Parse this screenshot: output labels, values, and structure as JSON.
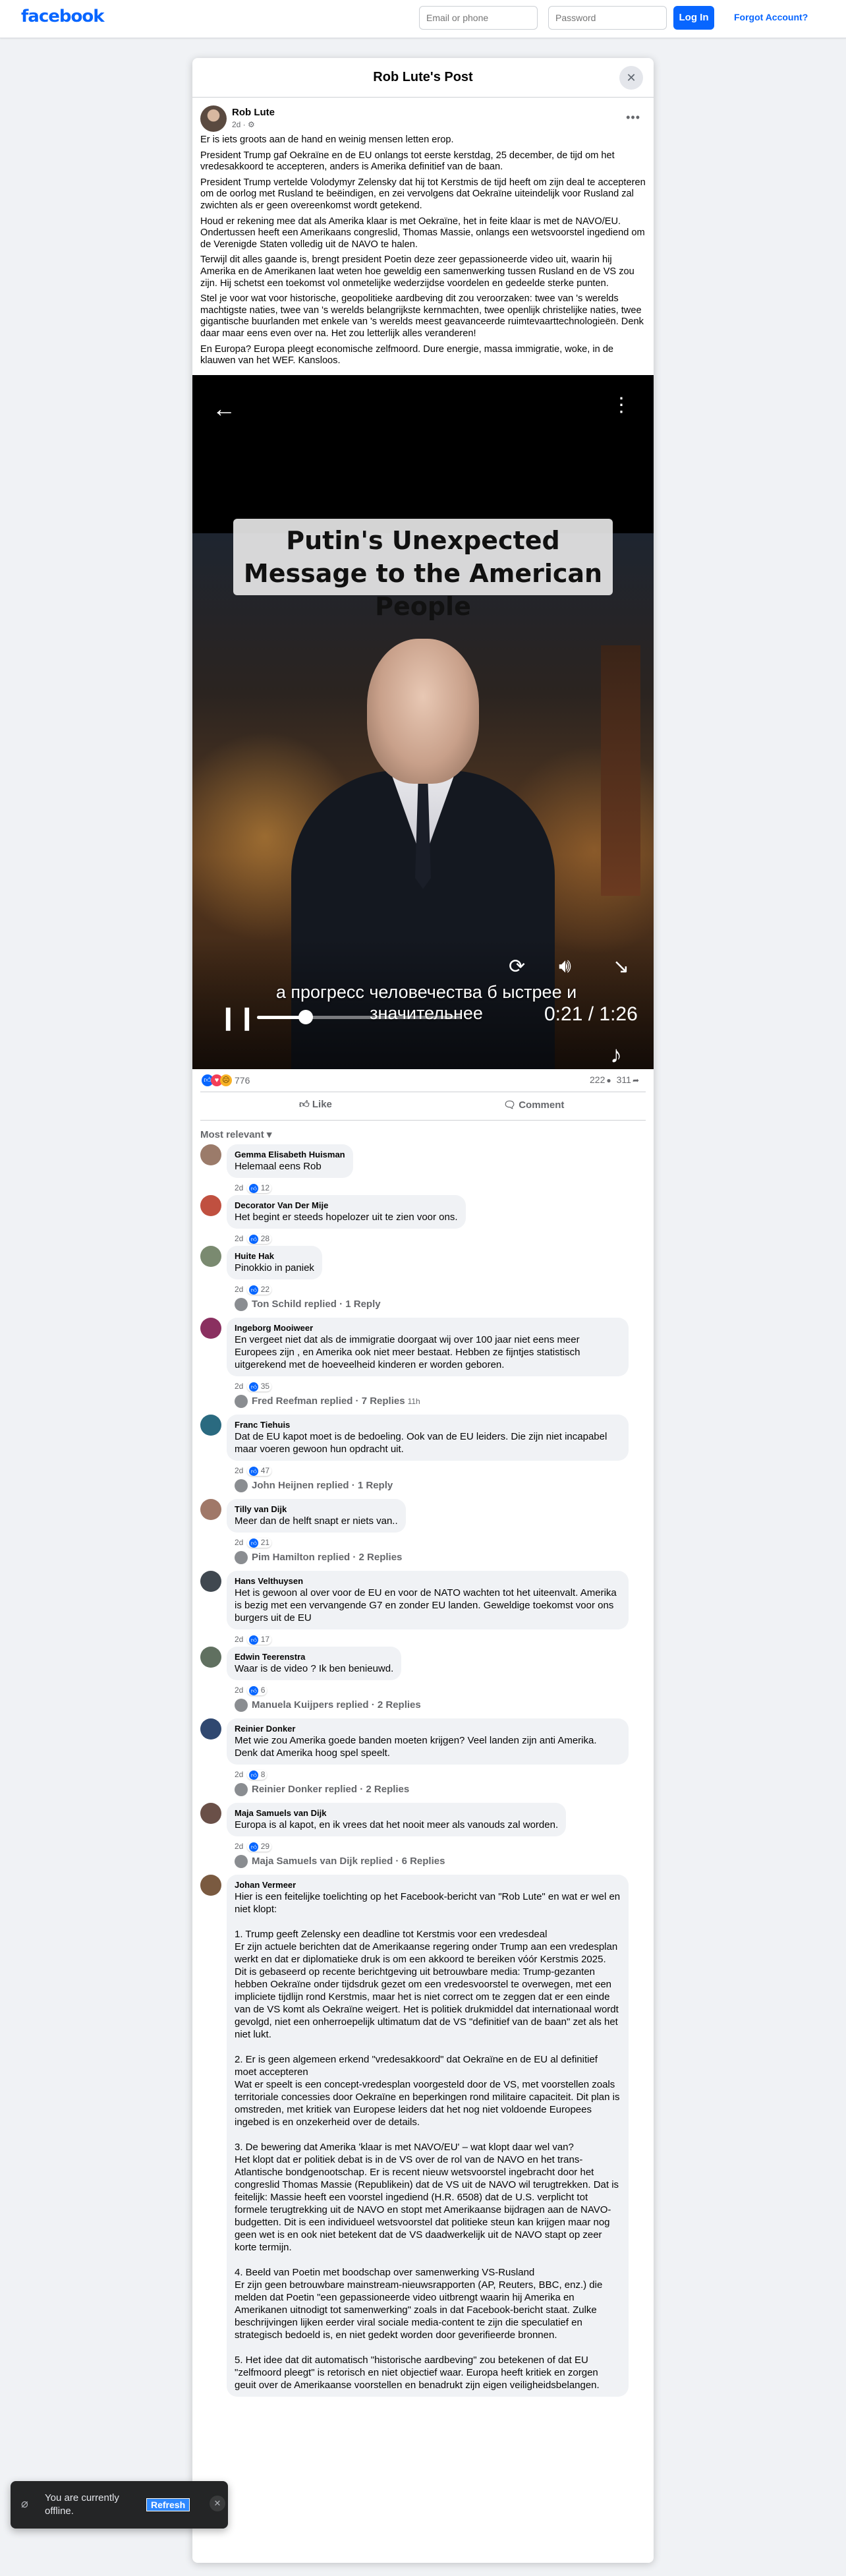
{
  "topbar": {
    "logo": "facebook",
    "email_placeholder": "Email or phone",
    "password_placeholder": "Password",
    "login_label": "Log In",
    "forgot_label": "Forgot Account?"
  },
  "post": {
    "title": "Rob Lute's Post",
    "close_icon": "close-icon",
    "author": "Rob Lute",
    "meta": "2d · ⚙",
    "more_icon": "more-icon",
    "paragraphs": [
      "Er is iets groots aan de hand en weinig mensen letten erop.",
      "President Trump gaf Oekraïne en de EU onlangs tot eerste kerstdag, 25 december, de tijd om het vredesakkoord te accepteren, anders is Amerika definitief van de baan.",
      "President Trump vertelde Volodymyr Zelensky dat hij tot Kerstmis de tijd heeft om zijn deal te accepteren om de oorlog met Rusland te beëindigen, en zei vervolgens dat Oekraïne uiteindelijk voor Rusland zal zwichten als er geen overeenkomst wordt getekend.",
      "Houd er rekening mee dat als Amerika klaar is met Oekraïne, het in feite klaar is met de NAVO/EU. Ondertussen heeft een Amerikaans congreslid, Thomas Massie, onlangs een wetsvoorstel ingediend om de Verenigde Staten volledig uit de NAVO te halen.",
      "Terwijl dit alles gaande is, brengt president Poetin deze zeer gepassioneerde video uit, waarin hij Amerika en de Amerikanen laat weten hoe geweldig een samenwerking tussen Rusland en de VS zou zijn. Hij schetst een toekomst vol onmetelijke wederzijdse voordelen en gedeelde sterke punten.",
      "Stel je voor wat voor historische, geopolitieke aardbeving dit zou veroorzaken: twee van 's werelds machtigste naties, twee van 's werelds belangrijkste kernmachten, twee openlijk christelijke naties, twee gigantische buurlanden met enkele van 's werelds meest geavanceerde ruimtevaarttechnologieën. Denk daar maar eens even over na. Het zou letterlijk alles veranderen!",
      "En Europa? Europa pleegt economische zelfmoord. Dure energie, massa immigratie, woke, in de klauwen van het WEF. Kansloos."
    ]
  },
  "video": {
    "banner": "Putin's Unexpected Message to the American People",
    "subtitle": "а прогресс человечества б ыстрее и значительнее",
    "time": "0:21 / 1:26",
    "progress": 0.24,
    "back_icon": "arrow-left-icon",
    "more_icon": "vertical-dots-icon",
    "replay_icon": "replay-icon",
    "volume_icon": "volume-icon",
    "minimize_icon": "minimize-icon",
    "pause_icon": "pause-icon",
    "watermark_icon": "tiktok-icon"
  },
  "stats": {
    "reactions": "776",
    "comments": "222",
    "shares": "311"
  },
  "actions": {
    "like": "Like",
    "comment": "Comment"
  },
  "sort": "Most relevant ▾",
  "comments": [
    {
      "name": "Gemma Elisabeth Huisman",
      "text": "Helemaal eens Rob",
      "time": "2d",
      "likes": "12",
      "color": "#9b7b6a"
    },
    {
      "name": "Decorator Van Der Mije",
      "text": "Het begint er steeds hopelozer uit te zien voor ons.",
      "time": "2d",
      "likes": "28",
      "color": "#c05040"
    },
    {
      "name": "Huite Hak",
      "text": "Pinokkio in paniek",
      "time": "2d",
      "likes": "22",
      "color": "#7a8a70",
      "reply": "Ton Schild replied · 1 Reply"
    },
    {
      "name": "Ingeborg Mooiweer",
      "text": "En vergeet niet dat als de immigratie doorgaat wij over 100 jaar niet eens meer Europees zijn , en Amerika ook niet meer bestaat. Hebben ze fijntjes statistisch uitgerekend met de hoeveelheid kinderen er worden geboren.",
      "time": "2d",
      "likes": "35",
      "color": "#8a3060",
      "reply": "Fred Reefman replied · 7 Replies",
      "reply_time": "11h"
    },
    {
      "name": "Franc Tiehuis",
      "text": "Dat de EU kapot moet is de bedoeling. Ook van de EU leiders. Die zijn niet incapabel maar voeren gewoon hun opdracht uit.",
      "time": "2d",
      "likes": "47",
      "color": "#2a6a80",
      "reply": "John Heijnen replied · 1 Reply"
    },
    {
      "name": "Tilly van Dijk",
      "text": "Meer dan de helft snapt er niets van..",
      "time": "2d",
      "likes": "21",
      "color": "#a07868",
      "reply": "Pim Hamilton replied · 2 Replies"
    },
    {
      "name": "Hans Velthuysen",
      "text": "Het is gewoon al over voor de EU en voor de NATO wachten tot het uiteenvalt. Amerika is bezig met een vervangende G7 en zonder EU landen. Geweldige toekomst voor ons burgers uit de EU",
      "time": "2d",
      "likes": "17",
      "color": "#404850"
    },
    {
      "name": "Edwin Teerenstra",
      "text": "Waar is de video ? Ik ben benieuwd.",
      "time": "2d",
      "likes": "6",
      "color": "#607060",
      "reply": "Manuela Kuijpers replied · 2 Replies"
    },
    {
      "name": "Reinier Donker",
      "text": "Met wie zou Amerika goede banden moeten krijgen? Veel landen zijn anti Amerika. Denk dat Amerika hoog spel speelt.",
      "time": "2d",
      "likes": "8",
      "color": "#304870",
      "reply": "Reinier Donker replied · 2 Replies"
    },
    {
      "name": "Maja Samuels van Dijk",
      "text": "Europa is al kapot, en ik vrees dat het nooit meer als vanouds zal worden.",
      "time": "2d",
      "likes": "29",
      "color": "#6a5048",
      "reply": "Maja Samuels van Dijk replied · 6 Replies"
    },
    {
      "name": "Johan Vermeer",
      "text": "Hier is een feitelijke toelichting op het Facebook-bericht van \"Rob Lute\" en wat er wel en niet klopt:\n\n1. Trump geeft Zelensky een deadline tot Kerstmis voor een vredesdeal\nEr zijn actuele berichten dat de Amerikaanse regering onder Trump aan een vredesplan werkt en dat er diplomatieke druk is om een akkoord te bereiken vóór Kerstmis 2025. Dit is gebaseerd op recente berichtgeving uit betrouwbare media: Trump-gezanten hebben Oekraïne onder tijdsdruk gezet om een vredesvoorstel te overwegen, met een impliciete tijdlijn rond Kerstmis, maar het is niet correct om te zeggen dat er een einde van de VS komt als Oekraïne weigert. Het is politiek drukmiddel dat internationaal wordt gevolgd, niet een onherroepelijk ultimatum dat de VS \"definitief van de baan\" zet als het niet lukt.\n\n2. Er is geen algemeen erkend \"vredesakkoord\" dat Oekraïne en de EU al definitief moet accepteren\nWat er speelt is een concept-vredesplan voorgesteld door de VS, met voorstellen zoals territoriale concessies door Oekraïne en beperkingen rond militaire capaciteit. Dit plan is omstreden, met kritiek van Europese leiders dat het nog niet voldoende Europees ingebed is en onzekerheid over de details.\n\n3. De bewering dat Amerika 'klaar is met NAVO/EU' – wat klopt daar wel van?\nHet klopt dat er politiek debat is in de VS over de rol van de NAVO en het trans-Atlantische bondgenootschap. Er is recent nieuw wetsvoorstel ingebracht door het congreslid Thomas Massie (Republikein) dat de VS uit de NAVO wil terugtrekken. Dat is feitelijk: Massie heeft een voorstel ingediend (H.R. 6508) dat de U.S. verplicht tot formele terugtrekking uit de NAVO en stopt met Amerikaanse bijdragen aan de NAVO-budgetten. Dit is een individueel wetsvoorstel dat politieke steun kan krijgen maar nog geen wet is en ook niet betekent dat de VS daadwerkelijk uit de NAVO stapt op zeer korte termijn.\n\n4. Beeld van Poetin met boodschap over samenwerking VS-Rusland\nEr zijn geen betrouwbare mainstream-nieuwsrapporten (AP, Reuters, BBC, enz.) die melden dat Poetin \"een gepassioneerde video uitbrengt waarin hij Amerika en Amerikanen uitnodigt tot samenwerking\" zoals in dat Facebook-bericht staat. Zulke beschrijvingen lijken eerder viral sociale media-content te zijn die speculatief en strategisch bedoeld is, en niet gedekt worden door geverifieerde bronnen.\n\n5. Het idee dat dit automatisch \"historische aardbeving\" zou betekenen of dat EU \"zelfmoord pleegt\" is retorisch en niet objectief waar. Europa heeft kritiek en zorgen geuit over de Amerikaanse voorstellen en benadrukt zijn eigen veiligheidsbelangen.",
      "time": "",
      "likes": "",
      "color": "#7a5a40"
    }
  ],
  "offline": {
    "icon": "wifi-off-icon",
    "text": "You are currently offline.",
    "refresh": "Refresh",
    "close_icon": "close-icon"
  }
}
